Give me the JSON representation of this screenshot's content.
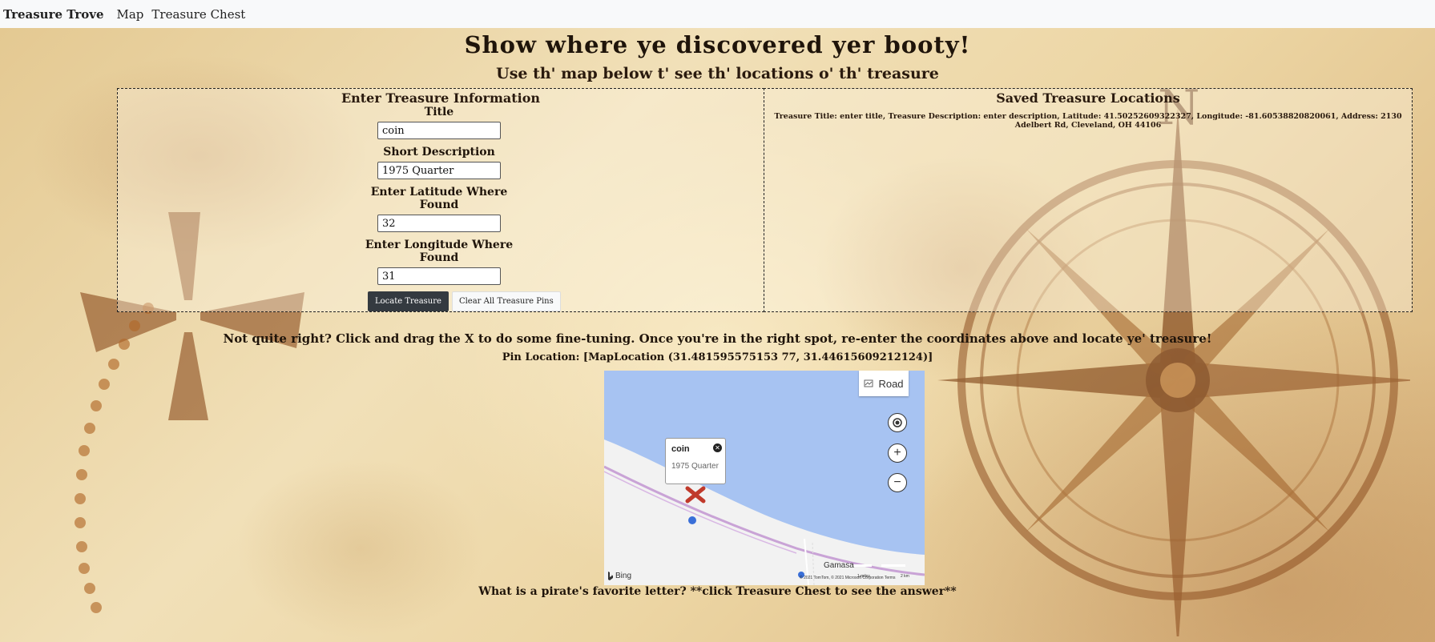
{
  "navbar": {
    "brand": "Treasure Trove",
    "links": [
      "Map",
      "Treasure Chest"
    ]
  },
  "page": {
    "headline": "Show where ye discovered yer booty!",
    "subline": "Use th' map below t' see th' locations o' th' treasure"
  },
  "form": {
    "title": "Enter Treasure Information",
    "title_label": "Title",
    "title_value": "coin",
    "description_label": "Short Description",
    "description_value": "1975 Quarter",
    "latitude_label": "Enter Latitude Where Found",
    "latitude_value": "32",
    "longitude_label": "Enter Longitude Where Found",
    "longitude_value": "31",
    "locate_button": "Locate Treasure",
    "clear_button": "Clear All Treasure Pins"
  },
  "saved": {
    "title": "Saved Treasure Locations",
    "entry": "Treasure Title: enter title, Treasure Description: enter description, Latitude: 41.50252609322327, Longitude: -81.60538820820061, Address: 2130 Adelbert Rd, Cleveland, OH 44106"
  },
  "hint": "Not quite right? Click and drag the X to do some fine-tuning. Once you're in the right spot, re-enter the coordinates above and locate ye' treasure!",
  "pin_location": "Pin Location: [MapLocation (31.481595575153 77, 31.44615609212124)]",
  "map": {
    "road_label": "Road",
    "popup_title": "coin",
    "popup_description": "1975 Quarter",
    "bing_label": "Bing",
    "place_label": "Gamasa",
    "scale_left": "1 miles",
    "scale_right": "2 km",
    "copyright": "© 2021 TomTom, © 2021 Microsoft Corporation  Terms",
    "icons": [
      "road-layer-icon",
      "locate-me-icon",
      "zoom-in-icon",
      "zoom-out-icon",
      "close-icon",
      "bing-logo-icon",
      "x-marker-icon"
    ]
  },
  "riddle": "What is a pirate's favorite letter? **click Treasure Chest to see the answer**",
  "colors": {
    "navbar_bg": "#f8f9fa",
    "dark_button": "#343a40",
    "map_water": "#a7c3f2",
    "map_land": "#f2f2f2",
    "pin_red": "#c0392b"
  }
}
